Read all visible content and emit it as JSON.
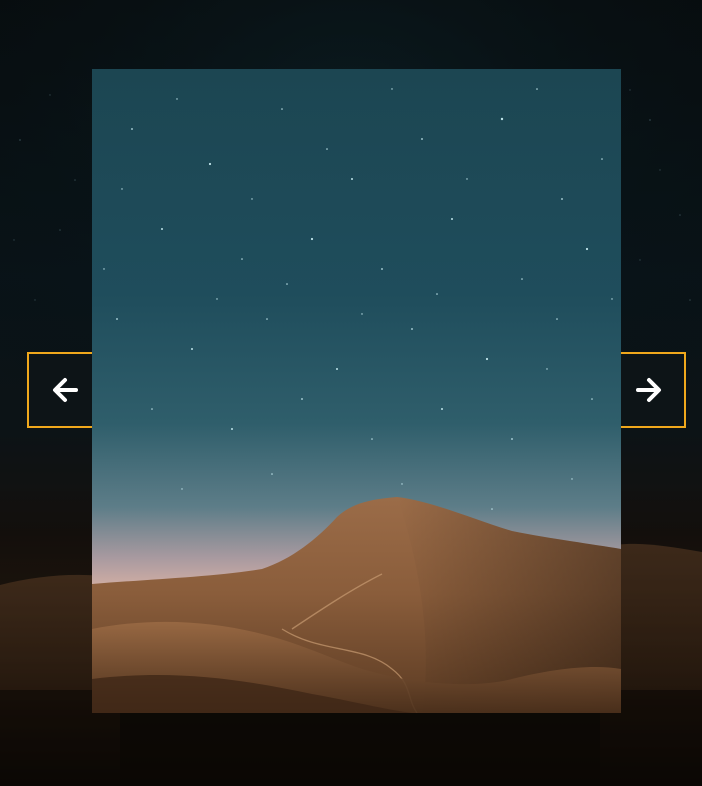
{
  "viewer": {
    "image_subject": "starry-sky-mountain",
    "prev_button": {
      "icon": "arrow-left-icon"
    },
    "next_button": {
      "icon": "arrow-right-icon"
    }
  },
  "colors": {
    "accent_border": "#f0a81c",
    "icon_color": "#ffffff",
    "sky_top": "#1f4b5a",
    "sky_horizon": "#e8b7a2",
    "mountain": "#8a5f3e"
  }
}
